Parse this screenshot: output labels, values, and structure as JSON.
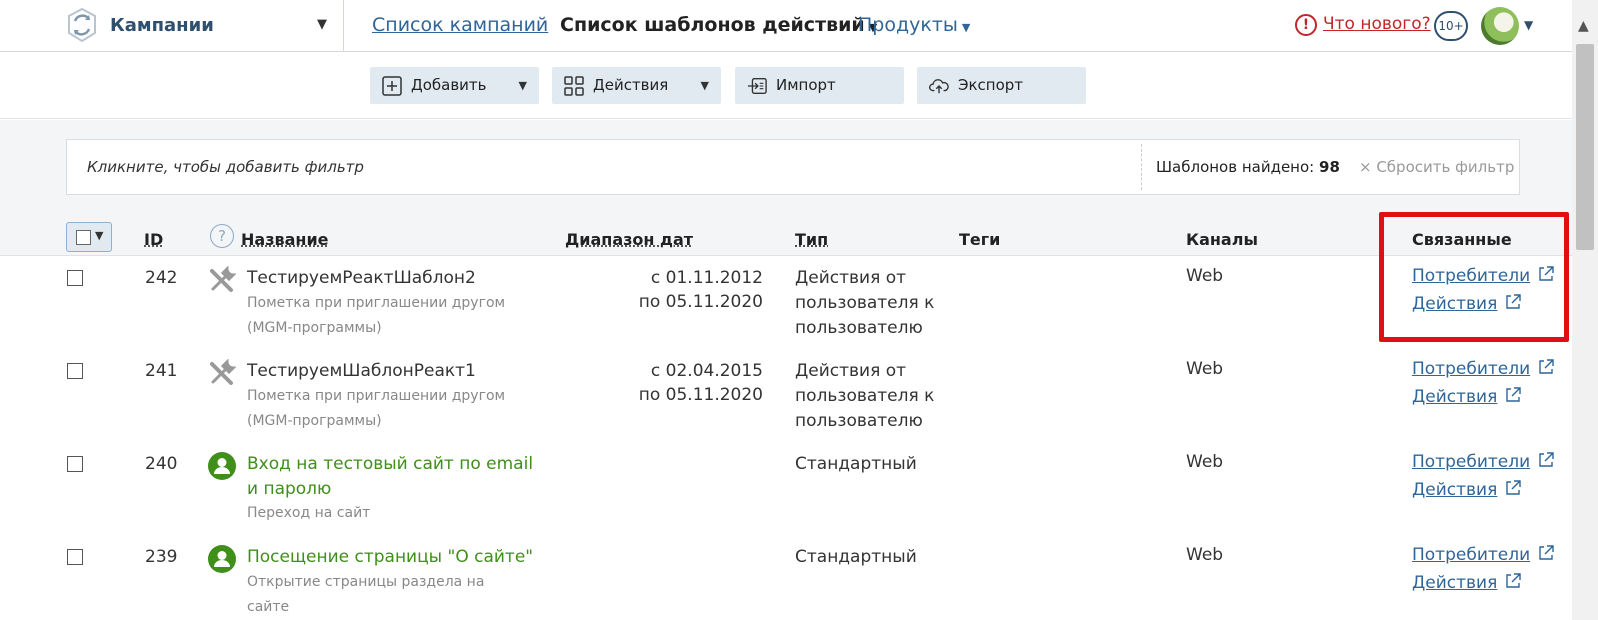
{
  "header": {
    "section": "Кампании",
    "nav": [
      "Список кампаний",
      "Список шаблонов действий",
      "Продукты"
    ],
    "whats_new": "Что нового?",
    "notifications": "10+"
  },
  "toolbar": {
    "add": "Добавить",
    "actions": "Действия",
    "import": "Импорт",
    "export": "Экспорт"
  },
  "filter": {
    "placeholder": "Кликните, чтобы добавить фильтр",
    "found_label": "Шаблонов найдено:",
    "found_count": "98",
    "reset": "× Сбросить фильтр"
  },
  "table": {
    "headers": {
      "id": "ID",
      "name": "Название",
      "dates": "Диапазон дат",
      "type": "Тип",
      "tags": "Теги",
      "channels": "Каналы",
      "related": "Связанные"
    },
    "rows": [
      {
        "id": "242",
        "icon": "tools-icon",
        "name": "ТестируемРеактШаблон2",
        "desc": "Пометка при приглашении другом (MGM-программы)",
        "date_from": "с 01.11.2012",
        "date_to": "по 05.11.2020",
        "type": "Действия от пользователя к пользователю",
        "channel": "Web",
        "rel1": "Потребители",
        "rel2": "Действия"
      },
      {
        "id": "241",
        "icon": "tools-icon",
        "name": "ТестируемШаблонРеакт1",
        "desc": "Пометка при приглашении другом (MGM-программы)",
        "date_from": "с 02.04.2015",
        "date_to": "по 05.11.2020",
        "type": "Действия от пользователя к пользователю",
        "channel": "Web",
        "rel1": "Потребители",
        "rel2": "Действия"
      },
      {
        "id": "240",
        "icon": "user-icon",
        "name": "Вход на тестовый сайт по email и паролю",
        "desc": "Переход на сайт",
        "date_from": "",
        "date_to": "",
        "type": "Стандартный",
        "channel": "Web",
        "rel1": "Потребители",
        "rel2": "Действия"
      },
      {
        "id": "239",
        "icon": "user-icon",
        "name": "Посещение страницы \"О сайте\"",
        "desc": "Открытие страницы раздела на сайте",
        "date_from": "",
        "date_to": "",
        "type": "Стандартный",
        "channel": "Web",
        "rel1": "Потребители",
        "rel2": "Действия"
      }
    ]
  },
  "colors": {
    "accent_link": "#2f6599",
    "green_name": "#3f8f1a",
    "highlight": "#e01010",
    "button_bg": "#e1e9f1"
  }
}
